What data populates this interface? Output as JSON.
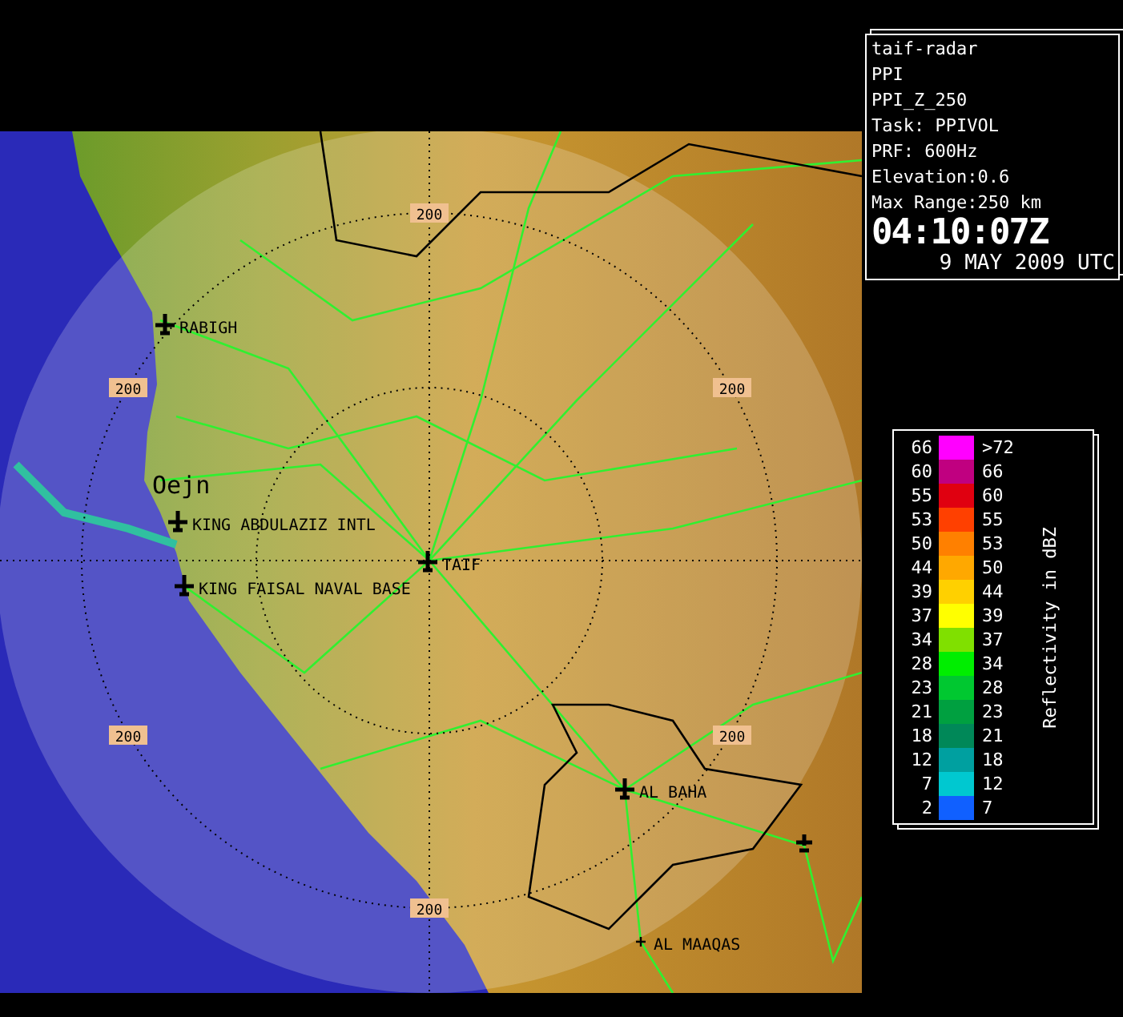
{
  "radar_info": {
    "lines": [
      "taif-radar",
      "PPI",
      "PPI_Z_250",
      "Task: PPIVOL",
      "PRF: 600Hz",
      "Elevation:0.6",
      "Max Range:250 km"
    ],
    "time": "04:10:07Z",
    "date": "9 MAY 2009 UTC"
  },
  "map": {
    "range_labels": [
      "200",
      "200",
      "200",
      "200",
      "200",
      "200"
    ],
    "places": [
      {
        "name": "RABIGH",
        "kind": "airport"
      },
      {
        "name": "Oejn",
        "kind": "station"
      },
      {
        "name": "KING ABDULAZIZ INTL",
        "kind": "airport"
      },
      {
        "name": "TAIF",
        "kind": "airport"
      },
      {
        "name": "KING FAISAL NAVAL BASE",
        "kind": "airport"
      },
      {
        "name": "AL BAHA",
        "kind": "airport"
      },
      {
        "name": "AL MAAQAS",
        "kind": "town"
      }
    ]
  },
  "legend": {
    "title": "Reflectivity in dBZ",
    "rows": [
      {
        "low": "66",
        "high": ">72",
        "color": "#ff00ff"
      },
      {
        "low": "60",
        "high": "66",
        "color": "#c00080"
      },
      {
        "low": "55",
        "high": "60",
        "color": "#e00010"
      },
      {
        "low": "53",
        "high": "55",
        "color": "#ff4000"
      },
      {
        "low": "50",
        "high": "53",
        "color": "#ff8000"
      },
      {
        "low": "44",
        "high": "50",
        "color": "#ffa800"
      },
      {
        "low": "39",
        "high": "44",
        "color": "#ffd000"
      },
      {
        "low": "37",
        "high": "39",
        "color": "#ffff00"
      },
      {
        "low": "34",
        "high": "37",
        "color": "#80e000"
      },
      {
        "low": "28",
        "high": "34",
        "color": "#00ee00"
      },
      {
        "low": "23",
        "high": "28",
        "color": "#00c830"
      },
      {
        "low": "21",
        "high": "23",
        "color": "#00a040"
      },
      {
        "low": "18",
        "high": "21",
        "color": "#008858"
      },
      {
        "low": "12",
        "high": "18",
        "color": "#00a0a0"
      },
      {
        "low": "7",
        "high": "12",
        "color": "#00c8d0"
      },
      {
        "low": "2",
        "high": "7",
        "color": "#1060ff"
      }
    ]
  }
}
